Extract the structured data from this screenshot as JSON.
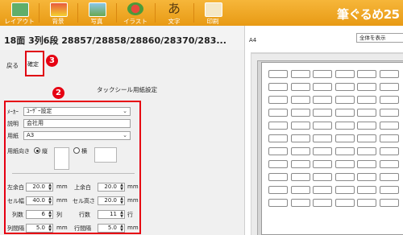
{
  "toolbar": {
    "layout_label": "レイアウト",
    "background_label": "背景",
    "photo_label": "写真",
    "illustration_label": "イラスト",
    "text_label": "文字",
    "text_icon_glyph": "あ",
    "print_label": "印刷",
    "app_logo": "筆ぐるめ25"
  },
  "info": {
    "page_info": "18面 3列6段  28857/28858/28860/28370/283..."
  },
  "panel": {
    "back_label": "戻る",
    "confirm_label": "確定",
    "badge_3": "3",
    "badge_2": "2",
    "title": "タックシール用紙設定"
  },
  "settings": {
    "maker_label": "ﾒｰｶｰ",
    "maker_value": "ﾕｰｻﾞｰ設定",
    "desc_label": "説明",
    "desc_value": "会社用",
    "paper_label": "用紙",
    "paper_value": "A3",
    "orientation_label": "用紙向き",
    "portrait_label": "縦",
    "landscape_label": "横",
    "left_margin_label": "左余白",
    "left_margin_value": "20.0",
    "top_margin_label": "上余白",
    "top_margin_value": "20.0",
    "cell_width_label": "セル幅",
    "cell_width_value": "40.0",
    "cell_height_label": "セル高さ",
    "cell_height_value": "20.0",
    "cols_label": "列数",
    "cols_value": "6",
    "cols_unit": "列",
    "rows_label": "行数",
    "rows_value": "11",
    "rows_unit": "行",
    "col_gap_label": "列間隔",
    "col_gap_value": "5.0",
    "row_gap_label": "行間隔",
    "row_gap_value": "5.0",
    "unit_mm": "mm",
    "dropdown_arrow": "⌄"
  },
  "preview": {
    "paper_size": "A4",
    "zoom_value": "全体を表示",
    "columns": 6,
    "rows": 11
  },
  "colors": {
    "accent_toolbar": "#f0a020",
    "highlight_red": "#e60012"
  }
}
